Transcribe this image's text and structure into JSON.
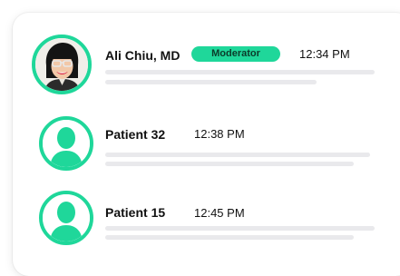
{
  "messages": [
    {
      "name": "Ali Chiu, MD",
      "badge": "Moderator",
      "time": "12:34 PM",
      "avatar": "doctor-photo"
    },
    {
      "name": "Patient 32",
      "time": "12:38 PM",
      "avatar": "person-silhouette-icon"
    },
    {
      "name": "Patient 15",
      "time": "12:45 PM",
      "avatar": "person-silhouette-icon"
    }
  ],
  "colors": {
    "accent": "#1fd79a",
    "placeholder_line": "#e9e9ec",
    "text": "#111111"
  }
}
